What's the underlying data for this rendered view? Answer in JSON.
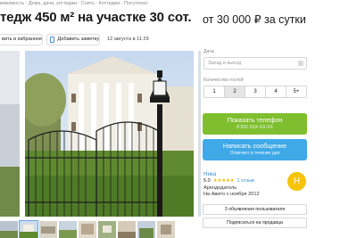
{
  "breadcrumbs": "вижимость · Дома, дачи, коттеджи · Снять · Коттеджи · Посуточно",
  "listing": {
    "title": "тедж 450 м² на участке 30 сот.",
    "price": "от 30 000 ₽ за сутки",
    "favorite_label": "вить в избранное",
    "note_label": "Добавить заметку",
    "date": "12 августа в 11:29"
  },
  "booking": {
    "dates_label": "Даты",
    "dates_placeholder": "Заезд и выезд",
    "guests_label": "Количество гостей",
    "guest_options": [
      "1",
      "2",
      "3",
      "4",
      "5+"
    ],
    "selected_guests": "2"
  },
  "contact": {
    "phone_label": "Показать телефон",
    "phone_masked": "8 916 XXX-XX-XX",
    "message_label": "Написать сообщение",
    "message_sub": "Отвечает в течение дня"
  },
  "seller": {
    "name": "Ника",
    "rating": "5.0",
    "stars": "★★★★★",
    "reviews": "1 отзыв",
    "role": "Арендодатель",
    "since": "На Авито с ноября 2012",
    "avatar_letter": "Н",
    "avatar_color": "#f5c400"
  },
  "actions": {
    "ads_label": "3 объявления пользователя",
    "subscribe_label": "Подписаться на продавца"
  },
  "colors": {
    "phone_button": "#7fbf2f",
    "message_button": "#3fa9e8",
    "link": "#3b8fd6"
  },
  "gallery": {
    "thumbnail_count": 9,
    "active_thumbnail": 1
  }
}
